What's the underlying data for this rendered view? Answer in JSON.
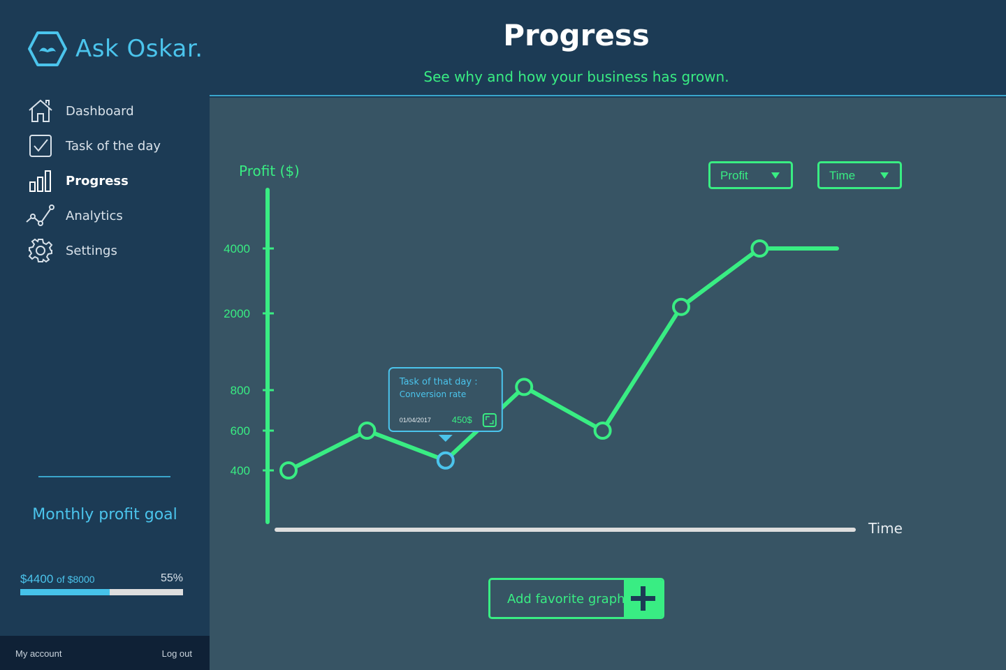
{
  "app": {
    "name": "Ask Oskar."
  },
  "colors": {
    "accent_green": "#39ed83",
    "accent_blue": "#4bc4ec",
    "sidebar_bg": "#1c3b55",
    "main_bg": "#375464",
    "footer_bg": "#0f2136"
  },
  "sidebar": {
    "items": [
      {
        "label": "Dashboard",
        "icon": "home-icon",
        "active": false
      },
      {
        "label": "Task of the day",
        "icon": "checkbox-icon",
        "active": false
      },
      {
        "label": "Progress",
        "icon": "bar-chart-icon",
        "active": true
      },
      {
        "label": "Analytics",
        "icon": "line-chart-icon",
        "active": false
      },
      {
        "label": "Settings",
        "icon": "gear-icon",
        "active": false
      }
    ],
    "goal": {
      "title": "Monthly profit goal",
      "current": "$4400",
      "of_text": "of $8000",
      "percent_label": "55%",
      "percent": 0.55
    },
    "footer": {
      "my_account": "My account",
      "log_out": "Log out"
    }
  },
  "header": {
    "title": "Progress",
    "subtitle": "See why and how your business has grown."
  },
  "controls": {
    "metric_dropdown": {
      "selected": "Profit"
    },
    "axis_dropdown": {
      "selected": "Time"
    }
  },
  "tooltip": {
    "title": "Task of that day :",
    "task": "Conversion rate",
    "date": "01/04/2017",
    "value": "450$"
  },
  "chart_data": {
    "type": "line",
    "ylabel": "Profit ($)",
    "xlabel": "Time",
    "y_ticks": [
      400,
      600,
      800,
      2000,
      4000
    ],
    "series": [
      {
        "values": [
          400,
          600,
          450,
          850,
          600,
          2200,
          4000,
          4000
        ]
      }
    ],
    "markers": [
      true,
      true,
      true,
      true,
      true,
      true,
      true,
      false
    ],
    "highlighted_index": 2,
    "y_scale": "piecewise",
    "grid": false
  },
  "actions": {
    "add_favorite_graph": "Add favorite graph"
  }
}
